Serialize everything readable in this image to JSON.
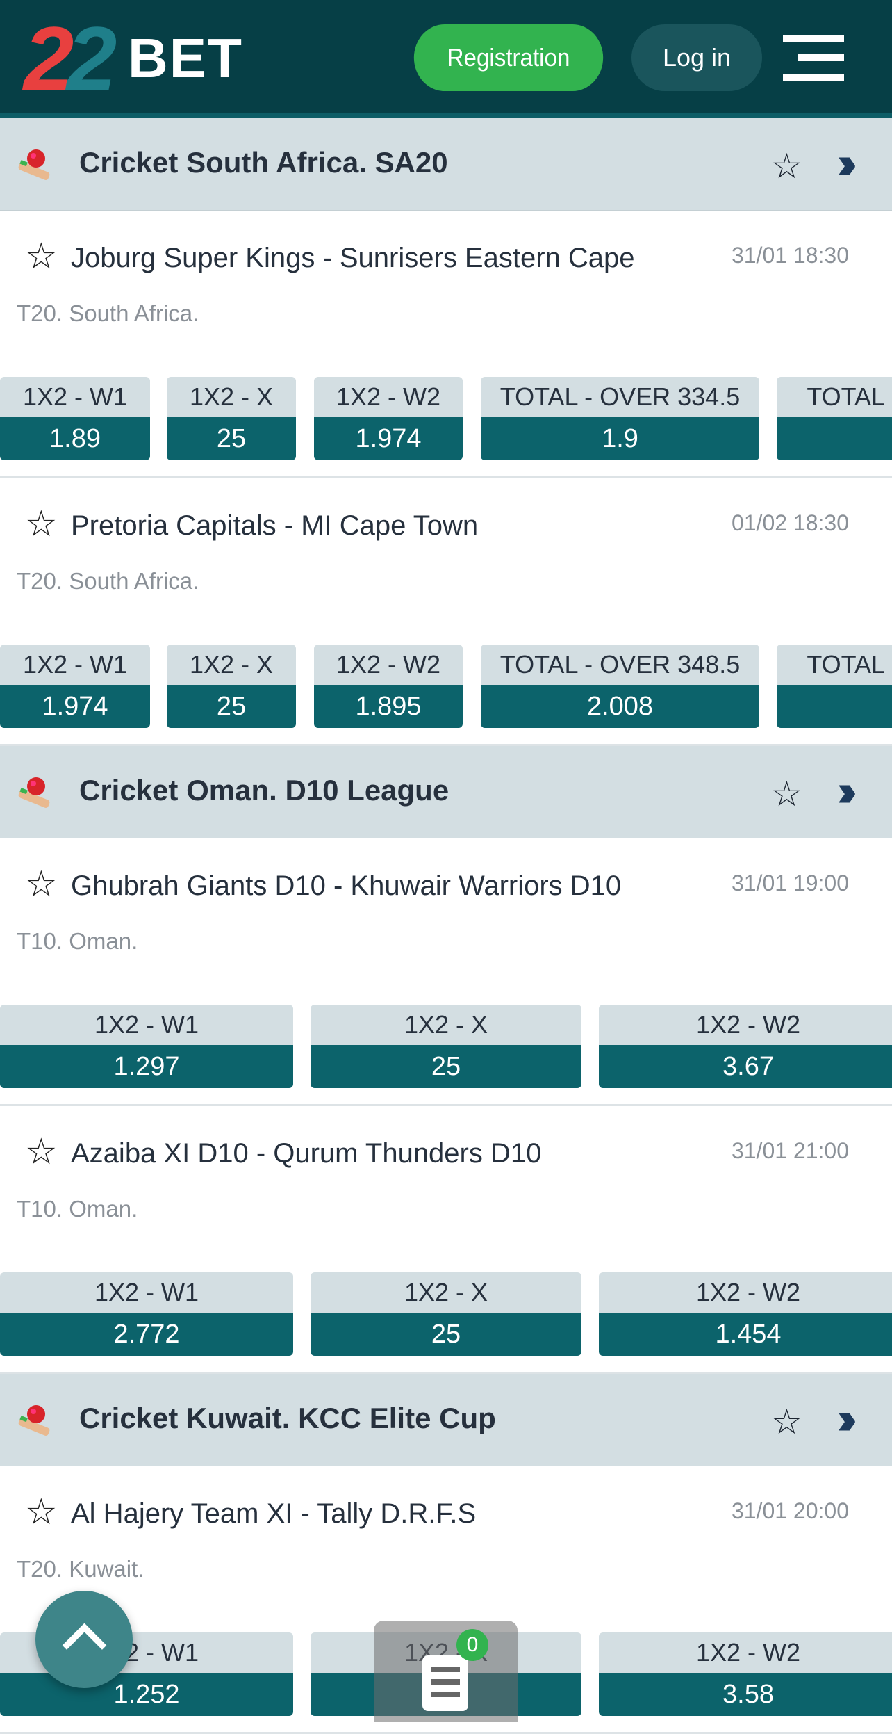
{
  "header": {
    "logo_text": "22BET",
    "logo_digits": "22",
    "logo_word": "BET",
    "registration_label": "Registration",
    "login_label": "Log in",
    "menu_icon": "hamburger-icon"
  },
  "colors": {
    "header_bg": "#063f46",
    "accent_green": "#32b34f",
    "odds_value_bg": "#0c636b",
    "odds_label_bg": "#d3dee2"
  },
  "sections": [
    {
      "title": "Cricket South Africa. SA20",
      "icon": "cricket-icon",
      "matches": [
        {
          "teams": "Joburg Super Kings - Sunrisers Eastern Cape",
          "time": "31/01 18:30",
          "league": "T20. South Africa.",
          "markets": [
            {
              "label": "1X2 - W1",
              "value": "1.89"
            },
            {
              "label": "1X2 - X",
              "value": "25"
            },
            {
              "label": "1X2 - W2",
              "value": "1.974"
            },
            {
              "label": "TOTAL - OVER 334.5",
              "value": "1.9"
            },
            {
              "label": "TOTAL -",
              "value": ""
            }
          ]
        },
        {
          "teams": "Pretoria Capitals - MI Cape Town",
          "time": "01/02 18:30",
          "league": "T20. South Africa.",
          "markets": [
            {
              "label": "1X2 - W1",
              "value": "1.974"
            },
            {
              "label": "1X2 - X",
              "value": "25"
            },
            {
              "label": "1X2 - W2",
              "value": "1.895"
            },
            {
              "label": "TOTAL - OVER 348.5",
              "value": "2.008"
            },
            {
              "label": "TOTAL -",
              "value": ""
            }
          ]
        }
      ]
    },
    {
      "title": "Cricket Oman. D10 League",
      "icon": "cricket-icon",
      "matches": [
        {
          "teams": "Ghubrah Giants D10 - Khuwair Warriors D10",
          "time": "31/01 19:00",
          "league": "T10. Oman.",
          "markets": [
            {
              "label": "1X2 - W1",
              "value": "1.297"
            },
            {
              "label": "1X2 - X",
              "value": "25"
            },
            {
              "label": "1X2 - W2",
              "value": "3.67"
            }
          ]
        },
        {
          "teams": "Azaiba XI D10 - Qurum Thunders D10",
          "time": "31/01 21:00",
          "league": "T10. Oman.",
          "markets": [
            {
              "label": "1X2 - W1",
              "value": "2.772"
            },
            {
              "label": "1X2 - X",
              "value": "25"
            },
            {
              "label": "1X2 - W2",
              "value": "1.454"
            }
          ]
        }
      ]
    },
    {
      "title": "Cricket Kuwait. KCC Elite Cup",
      "icon": "cricket-icon",
      "matches": [
        {
          "teams": "Al Hajery Team XI - Tally D.R.F.S",
          "time": "31/01 20:00",
          "league": "T20. Kuwait.",
          "markets": [
            {
              "label": "1X2 - W1",
              "value": "1.252"
            },
            {
              "label": "1X2 - X",
              "value": "25"
            },
            {
              "label": "1X2 - W2",
              "value": "3.58"
            }
          ]
        }
      ]
    }
  ],
  "betslip": {
    "count": "0"
  }
}
